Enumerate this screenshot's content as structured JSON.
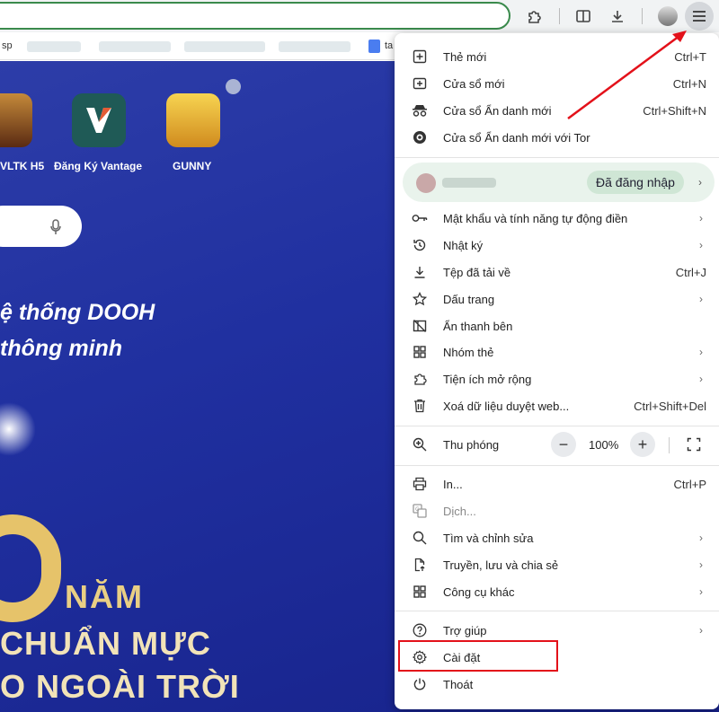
{
  "bookmarks_bar": {
    "first_text": "sp",
    "last_text": "ta"
  },
  "shortcuts": [
    {
      "label": "VLTK H5"
    },
    {
      "label": "Đăng Ký Vantage"
    },
    {
      "label": "GUNNY"
    }
  ],
  "hero": {
    "line1": "ệ thống DOOH",
    "line2": "thông minh",
    "line3": "NĂM",
    "line4": "CHUẨN MỰC",
    "line5": "O NGOÀI TRỜI"
  },
  "menu": {
    "items_top": [
      {
        "label": "Thẻ mới",
        "shortcut": "Ctrl+T",
        "icon": "new-tab-icon"
      },
      {
        "label": "Cửa sổ mới",
        "shortcut": "Ctrl+N",
        "icon": "new-window-icon"
      },
      {
        "label": "Cửa sổ Ẩn danh mới",
        "shortcut": "Ctrl+Shift+N",
        "icon": "incognito-icon"
      },
      {
        "label": "Cửa sổ Ẩn danh mới với Tor",
        "shortcut": "",
        "icon": "tor-icon"
      }
    ],
    "profile": {
      "badge": "Đã đăng nhập"
    },
    "items_mid": [
      {
        "label": "Mật khẩu và tính năng tự động điền",
        "shortcut": "",
        "arrow": true,
        "icon": "key-icon"
      },
      {
        "label": "Nhật ký",
        "shortcut": "",
        "arrow": true,
        "icon": "history-icon"
      },
      {
        "label": "Tệp đã tải về",
        "shortcut": "Ctrl+J",
        "arrow": false,
        "icon": "download-icon"
      },
      {
        "label": "Dấu trang",
        "shortcut": "",
        "arrow": true,
        "icon": "star-icon"
      },
      {
        "label": "Ẩn thanh bên",
        "shortcut": "",
        "arrow": false,
        "icon": "sidebar-icon"
      },
      {
        "label": "Nhóm thẻ",
        "shortcut": "",
        "arrow": true,
        "icon": "tab-groups-icon"
      },
      {
        "label": "Tiện ích mở rộng",
        "shortcut": "",
        "arrow": true,
        "icon": "puzzle-icon"
      },
      {
        "label": "Xoá dữ liệu duyệt web...",
        "shortcut": "Ctrl+Shift+Del",
        "arrow": false,
        "icon": "trash-icon"
      }
    ],
    "zoom": {
      "label": "Thu phóng",
      "value": "100%",
      "minus": "−",
      "plus": "+"
    },
    "items_bottom": [
      {
        "label": "In...",
        "shortcut": "Ctrl+P",
        "arrow": false,
        "icon": "print-icon"
      },
      {
        "label": "Dịch...",
        "shortcut": "",
        "arrow": false,
        "icon": "translate-icon",
        "disabled": true
      },
      {
        "label": "Tìm và chỉnh sửa",
        "shortcut": "",
        "arrow": true,
        "icon": "search-icon"
      },
      {
        "label": "Truyền, lưu và chia sẻ",
        "shortcut": "",
        "arrow": true,
        "icon": "share-icon"
      },
      {
        "label": "Công cụ khác",
        "shortcut": "",
        "arrow": true,
        "icon": "tools-icon"
      }
    ],
    "items_end": [
      {
        "label": "Trợ giúp",
        "shortcut": "",
        "arrow": true,
        "icon": "help-icon"
      },
      {
        "label": "Cài đặt",
        "shortcut": "",
        "arrow": false,
        "icon": "gear-icon"
      },
      {
        "label": "Thoát",
        "shortcut": "",
        "arrow": false,
        "icon": "power-icon"
      }
    ]
  },
  "colors": {
    "highlight": "#e3111a",
    "arrow": "#e3111a",
    "page_bg": "#2030a0"
  }
}
